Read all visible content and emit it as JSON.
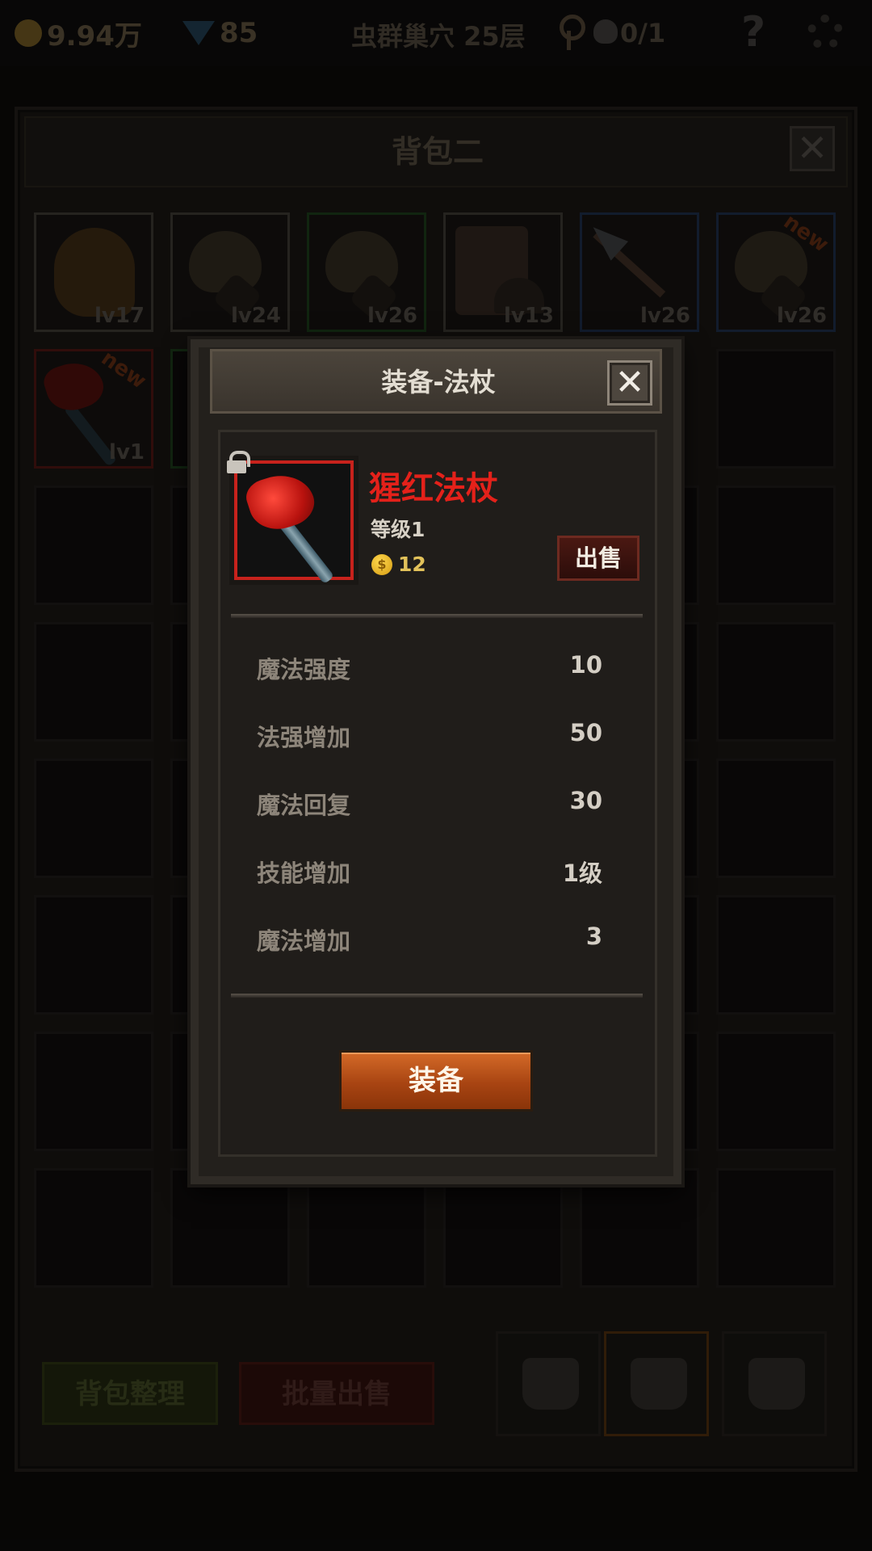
{
  "status_bar": {
    "gold": "9.94万",
    "gems": "85",
    "dungeon": "虫群巢穴 25层",
    "kills": "0/1",
    "help": "?"
  },
  "bag": {
    "title": "背包二",
    "close": "✕",
    "items": [
      {
        "level": "lv17"
      },
      {
        "level": "lv24"
      },
      {
        "level": "lv26"
      },
      {
        "level": "lv13"
      },
      {
        "level": "lv26"
      },
      {
        "level": "lv26",
        "badge": "new"
      },
      {
        "level": "lv1",
        "badge": "new"
      }
    ],
    "sort_button": "背包整理",
    "bulk_sell_button": "批量出售"
  },
  "modal": {
    "title": "装备-法杖",
    "close": "✕",
    "item": {
      "name": "猩红法杖",
      "level": "等级1",
      "coin_symbol": "$",
      "price": "12",
      "sell_button": "出售"
    },
    "stats": [
      {
        "name": "魔法强度",
        "value": "10"
      },
      {
        "name": "法强增加",
        "value": "50"
      },
      {
        "name": "魔法回复",
        "value": "30"
      },
      {
        "name": "技能增加",
        "value": "1级"
      },
      {
        "name": "魔法增加",
        "value": "3"
      }
    ],
    "equip_button": "装备"
  },
  "colors": {
    "item_name": "#e4211a",
    "equip_button": "#c0531d",
    "rarity_red": "#c7221c"
  }
}
